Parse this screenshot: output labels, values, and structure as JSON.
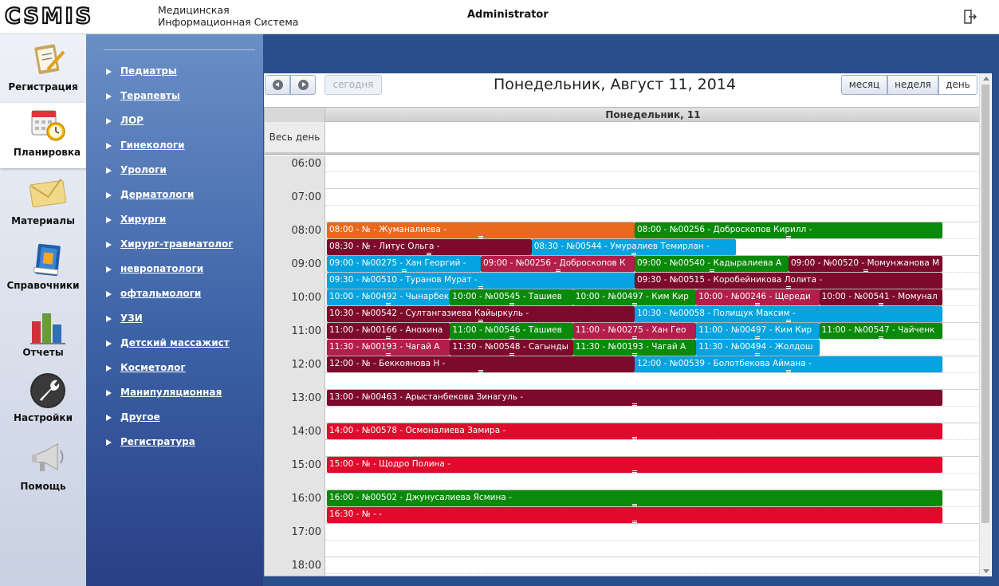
{
  "header": {
    "logo": "CSMIS",
    "subtitle_line1": "Медицинская",
    "subtitle_line2": "Информационная Система",
    "user": "Administrator",
    "logout_icon": "logout-icon"
  },
  "nav": [
    {
      "label": "Регистрация",
      "icon": "clipboard-icon"
    },
    {
      "label": "Планировка",
      "icon": "calendar-clock-icon",
      "active": true
    },
    {
      "label": "Материалы",
      "icon": "envelope-icon"
    },
    {
      "label": "Справочники",
      "icon": "book-icon"
    },
    {
      "label": "Отчеты",
      "icon": "bar-chart-icon"
    },
    {
      "label": "Настройки",
      "icon": "wrench-icon"
    },
    {
      "label": "Помощь",
      "icon": "megaphone-icon"
    }
  ],
  "doctors": [
    "Педиатры",
    "Терапевты",
    "ЛОР",
    "Гинекологи",
    "Урологи",
    "Дерматологи",
    "Хирурги",
    "Хирург-травматолог",
    "невропатологи",
    "офтальмологи",
    "УЗИ",
    "Детский массажист",
    "Косметолог",
    "Манипуляционная",
    "Другое",
    "Регистратура"
  ],
  "calendar": {
    "title": "Понедельник, Август 11, 2014",
    "today_label": "сегодня",
    "views": {
      "month": "месяц",
      "week": "неделя",
      "day": "день"
    },
    "active_view": "day",
    "column_header": "Понедельник, 11",
    "allday_label": "Весь день",
    "hours": [
      "06:00",
      "07:00",
      "08:00",
      "09:00",
      "10:00",
      "11:00",
      "12:00",
      "13:00",
      "14:00",
      "15:00",
      "16:00",
      "17:00",
      "18:00"
    ],
    "colors": {
      "orange": "#e8691e",
      "maroon": "#7d0a2c",
      "crimson": "#b31e4a",
      "red": "#e00b2c",
      "green": "#0a8a0a",
      "blue": "#05a3e0"
    },
    "events": [
      {
        "text": "08:00 - № - Жуманалиева -",
        "start": "08:00",
        "lane": 0,
        "span": 2,
        "color": "orange"
      },
      {
        "text": "08:00 - №00256 - Доброскопов Кирилл -",
        "start": "08:00",
        "lane": 2,
        "span": 2,
        "color": "green"
      },
      {
        "text": "08:30 - № - Литус Ольга -",
        "start": "08:30",
        "lane": 0,
        "span": 1.33,
        "color": "maroon"
      },
      {
        "text": "08:30 - №00544 - Умуралиев Темирлан -",
        "start": "08:30",
        "lane": 1.33,
        "span": 1.33,
        "color": "blue"
      },
      {
        "text": "09:00 - №00275 - Хан Георгий -",
        "start": "09:00",
        "lane": 0,
        "span": 1,
        "color": "blue"
      },
      {
        "text": "09:00 - №00256 - Доброскопов К",
        "start": "09:00",
        "lane": 1,
        "span": 1,
        "color": "crimson"
      },
      {
        "text": "09:00 - №00540 - Кадыралиева А",
        "start": "09:00",
        "lane": 2,
        "span": 1,
        "color": "green"
      },
      {
        "text": "09:00 - №00520 - Момунжанова М",
        "start": "09:00",
        "lane": 3,
        "span": 1,
        "color": "maroon"
      },
      {
        "text": "09:30 - №00510 - Туранов Мурат -",
        "start": "09:30",
        "lane": 0,
        "span": 2,
        "color": "blue"
      },
      {
        "text": "09:30 - №00515 - Коробейникова Лолита -",
        "start": "09:30",
        "lane": 2,
        "span": 2,
        "color": "maroon"
      },
      {
        "text": "10:00 - №00492 - Чынарбек",
        "start": "10:00",
        "lane": 0,
        "span": 0.8,
        "color": "blue"
      },
      {
        "text": "10:00 - №00545 - Ташиев",
        "start": "10:00",
        "lane": 0.8,
        "span": 0.8,
        "color": "green"
      },
      {
        "text": "10:00 - №00497 - Ким Кир",
        "start": "10:00",
        "lane": 1.6,
        "span": 0.8,
        "color": "green"
      },
      {
        "text": "10:00 - №00246 - Щереди",
        "start": "10:00",
        "lane": 2.4,
        "span": 0.8,
        "color": "crimson"
      },
      {
        "text": "10:00 - №00541 - Момунал",
        "start": "10:00",
        "lane": 3.2,
        "span": 0.8,
        "color": "maroon"
      },
      {
        "text": "10:30 - №00542 - Султангазиева Кайыркуль -",
        "start": "10:30",
        "lane": 0,
        "span": 2,
        "color": "maroon"
      },
      {
        "text": "10:30 - №00058 - Полищук Максим -",
        "start": "10:30",
        "lane": 2,
        "span": 2,
        "color": "blue"
      },
      {
        "text": "11:00 - №00166 - Анохина",
        "start": "11:00",
        "lane": 0,
        "span": 0.8,
        "color": "maroon"
      },
      {
        "text": "11:00 - №00546 - Ташиев",
        "start": "11:00",
        "lane": 0.8,
        "span": 0.8,
        "color": "green"
      },
      {
        "text": "11:00 - №00275 - Хан Гео",
        "start": "11:00",
        "lane": 1.6,
        "span": 0.8,
        "color": "crimson"
      },
      {
        "text": "11:00 - №00497 - Ким Кир",
        "start": "11:00",
        "lane": 2.4,
        "span": 0.8,
        "color": "blue"
      },
      {
        "text": "11:00 - №00547 - Чайченк",
        "start": "11:00",
        "lane": 3.2,
        "span": 0.8,
        "color": "green"
      },
      {
        "text": "11:30 - №00193 - Чагай А",
        "start": "11:30",
        "lane": 0,
        "span": 0.8,
        "color": "crimson"
      },
      {
        "text": "11:30 - №00548 - Сагынды",
        "start": "11:30",
        "lane": 0.8,
        "span": 0.8,
        "color": "maroon"
      },
      {
        "text": "11:30 - №00193 - Чагай А",
        "start": "11:30",
        "lane": 1.6,
        "span": 0.8,
        "color": "green"
      },
      {
        "text": "11:30 - №00494 - Жолдош",
        "start": "11:30",
        "lane": 2.4,
        "span": 0.8,
        "color": "blue"
      },
      {
        "text": "12:00 - № - Беккоянова Н -",
        "start": "12:00",
        "lane": 0,
        "span": 2,
        "color": "maroon"
      },
      {
        "text": "12:00 - №00539 - Болотбекова Аймана -",
        "start": "12:00",
        "lane": 2,
        "span": 2,
        "color": "blue"
      },
      {
        "text": "13:00 - №00463 - Арыстанбекова Зинагуль -",
        "start": "13:00",
        "lane": 0,
        "span": 4,
        "color": "maroon"
      },
      {
        "text": "14:00 - №00578 - Осмоналиева Замира -",
        "start": "14:00",
        "lane": 0,
        "span": 4,
        "color": "red"
      },
      {
        "text": "15:00 - № - Щодро Полина -",
        "start": "15:00",
        "lane": 0,
        "span": 4,
        "color": "red"
      },
      {
        "text": "16:00 - №00502 - Джунусалиева Ясмина -",
        "start": "16:00",
        "lane": 0,
        "span": 4,
        "color": "green"
      },
      {
        "text": "16:30 - № - -",
        "start": "16:30",
        "lane": 0,
        "span": 4,
        "color": "red"
      }
    ]
  }
}
